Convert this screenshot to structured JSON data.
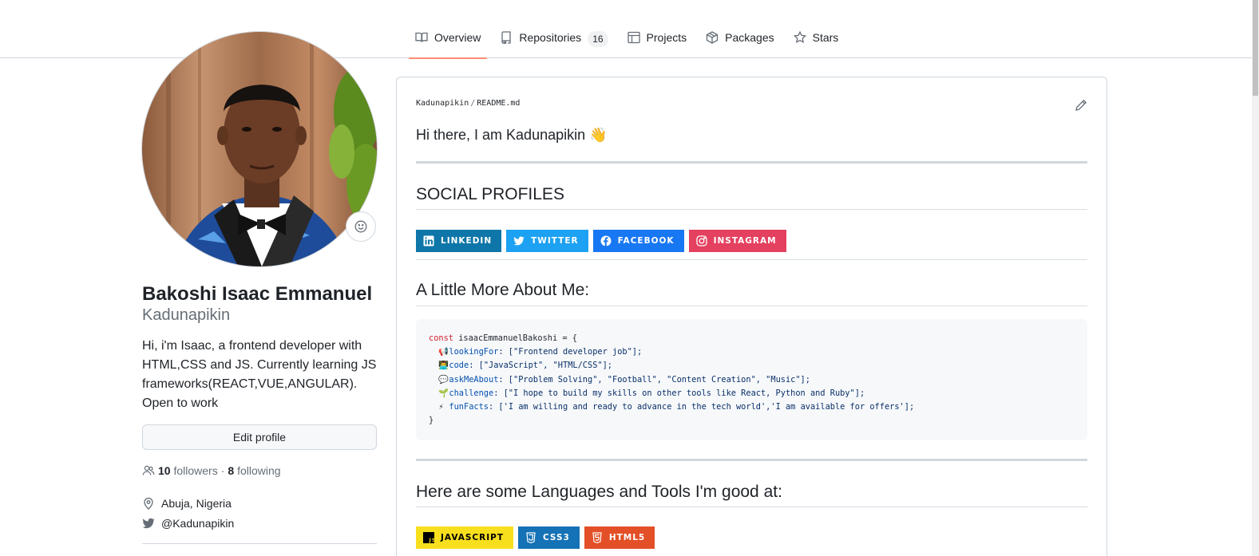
{
  "nav": {
    "tabs": [
      {
        "label": "Overview",
        "icon": "book-icon",
        "active": true
      },
      {
        "label": "Repositories",
        "icon": "repo-icon",
        "count": "16"
      },
      {
        "label": "Projects",
        "icon": "table-icon"
      },
      {
        "label": "Packages",
        "icon": "package-icon"
      },
      {
        "label": "Stars",
        "icon": "star-icon"
      }
    ]
  },
  "profile": {
    "fullname": "Bakoshi Isaac Emmanuel",
    "username": "Kadunapikin",
    "bio": "Hi, i'm Isaac, a frontend developer with HTML,CSS and JS. Currently learning JS frameworks(REACT,VUE,ANGULAR). Open to work",
    "edit_label": "Edit profile",
    "followers_count": "10",
    "followers_label": "followers",
    "dot": "·",
    "following_count": "8",
    "following_label": "following",
    "location": "Abuja, Nigeria",
    "twitter": "@Kadunapikin"
  },
  "readme": {
    "crumb_user": "Kadunapikin",
    "crumb_sep": "/",
    "crumb_file": "README.md",
    "greeting": "Hi there, I am Kadunapikin 👋",
    "social_heading": "SOCIAL PROFILES",
    "social_badges": [
      {
        "label": "LINKEDIN",
        "color": "#0e76a8",
        "icon": "linkedin-icon"
      },
      {
        "label": "TWITTER",
        "color": "#1da1f2",
        "icon": "twitter-icon"
      },
      {
        "label": "FACEBOOK",
        "color": "#1877f2",
        "icon": "facebook-icon"
      },
      {
        "label": "INSTAGRAM",
        "color": "#e4405f",
        "icon": "instagram-icon"
      }
    ],
    "about_heading": "A Little More About Me:",
    "code": {
      "line1_kw": "const",
      "line1_var": " isaacEmmanuelBakoshi = {",
      "lines": [
        {
          "emoji": "📢",
          "prop": "lookingFor",
          "rest": ": [\"Frontend developer job\"];"
        },
        {
          "emoji": "👨‍💻",
          "prop": "code",
          "rest": ": [\"JavaScript\", \"HTML/CSS\"];"
        },
        {
          "emoji": "💬",
          "prop": "askMeAbout",
          "rest": ": [\"Problem Solving\", \"Football\", \"Content Creation\", \"Music\"];"
        },
        {
          "emoji": "🌱",
          "prop": "challenge",
          "rest": ": [\"I hope to build my skills on other tools like React, Python and Ruby\"];"
        },
        {
          "emoji": "⚡",
          "prop": "funFacts",
          "rest": ": ['I am willing and ready to advance in the tech world','I am available for offers'];"
        }
      ],
      "closing": "}"
    },
    "tools_heading": "Here are some Languages and Tools I'm good at:",
    "tool_badges": [
      {
        "label": "JAVASCRIPT",
        "color": "#f7df1e",
        "text_color": "#000000",
        "icon": "javascript-icon"
      },
      {
        "label": "CSS3",
        "color": "#1572b6",
        "text_color": "#ffffff",
        "icon": "css3-icon"
      },
      {
        "label": "HTML5",
        "color": "#e34f26",
        "text_color": "#ffffff",
        "icon": "html5-icon"
      }
    ]
  }
}
